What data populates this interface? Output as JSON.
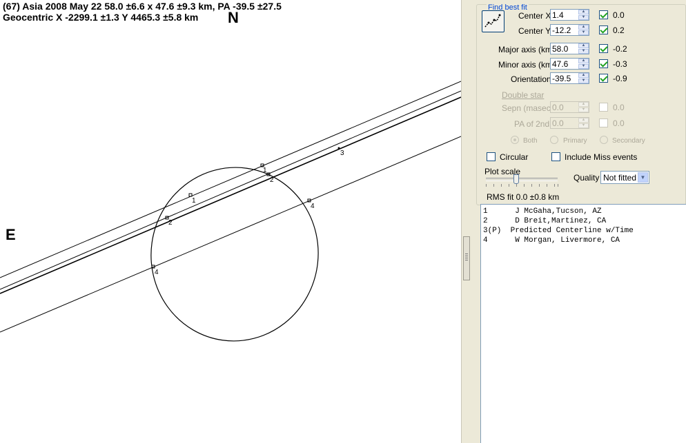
{
  "plot": {
    "title_line1": "(67) Asia  2008 May 22  58.0 ±6.6 x 47.6 ±9.3 km, PA -39.5 ±27.5",
    "title_line2": "Geocentric  X  -2299.1 ±1.3  Y 4465.3 ±5.8 km",
    "north_label": "N",
    "east_label": "E",
    "chord_labels": {
      "c1": "1",
      "c2": "2",
      "c3": "3",
      "c4": "4"
    }
  },
  "fit_group": {
    "title": "Find best fit",
    "fit_button_icon": "fit-curve-icon",
    "rows": [
      {
        "label": "Center X",
        "value": "1.4",
        "checked": true,
        "residual": "0.0"
      },
      {
        "label": "Center Y",
        "value": "-12.2",
        "checked": true,
        "residual": "0.2"
      },
      {
        "label": "Major axis (km)",
        "value": "58.0",
        "checked": true,
        "residual": "-0.2"
      },
      {
        "label": "Minor axis (km)",
        "value": "47.6",
        "checked": true,
        "residual": "-0.3"
      },
      {
        "label": "Orientation",
        "value": "-39.5",
        "checked": true,
        "residual": "-0.9"
      }
    ],
    "double_star": {
      "label": "Double star",
      "rows": [
        {
          "label": "Sepn (masec)",
          "value": "0.0",
          "checked": false,
          "residual": "0.0"
        },
        {
          "label": "PA of 2nd",
          "value": "0.0",
          "checked": false,
          "residual": "0.0"
        }
      ],
      "radios": [
        "Both",
        "Primary",
        "Secondary"
      ],
      "selected": "Both"
    },
    "circular_label": "Circular",
    "circular_checked": false,
    "include_miss_label": "Include Miss events",
    "include_miss_checked": false,
    "plot_scale_label": "Plot scale",
    "plot_scale_fraction": 0.42,
    "quality_label": "Quality",
    "quality_value": "Not fitted",
    "rms_text": "RMS fit 0.0 ±0.8 km"
  },
  "observers": [
    "1      J McGaha,Tucson, AZ",
    "2      D Breit,Martinez, CA",
    "3(P)  Predicted Centerline w/Time",
    "4      W Morgan, Livermore, CA"
  ]
}
